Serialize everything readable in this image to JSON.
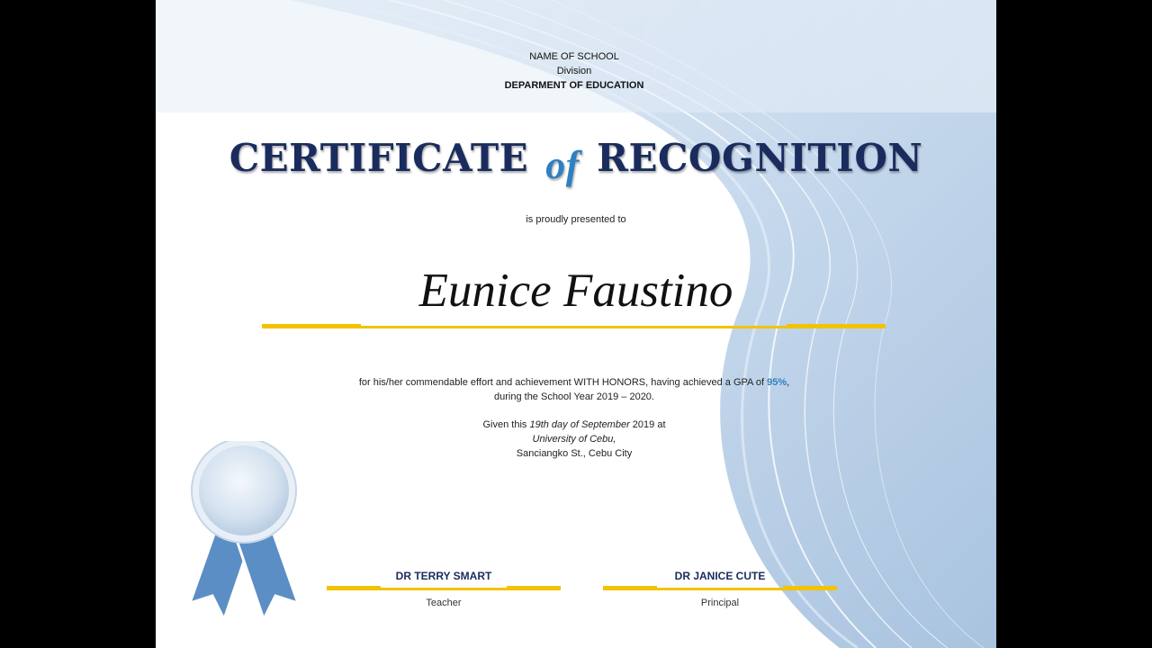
{
  "header": {
    "school": "NAME OF SCHOOL",
    "division": "Division",
    "department": "DEPARMENT OF EDUCATION"
  },
  "title": {
    "part1": "CERTIFICATE",
    "of": "of",
    "part2": "RECOGNITION"
  },
  "presented_to": "is proudly presented to",
  "recipient": "Eunice Faustino",
  "body": {
    "line1_prefix": "for his/her commendable effort and  achievement WITH HONORS, having achieved a GPA of ",
    "gpa": "95%",
    "line1_suffix": ",",
    "line2": "during the  School Year 2019 – 2020."
  },
  "given": {
    "prefix": "Given this ",
    "date": "19th day of September",
    "suffix": " 2019 at",
    "place": "University of Cebu,",
    "address": "Sanciangko St., Cebu City"
  },
  "signatories": {
    "teacher": {
      "name": "DR TERRY SMART",
      "role": "Teacher"
    },
    "principal": {
      "name": "DR JANICE CUTE",
      "role": "Principal"
    }
  },
  "colors": {
    "title": "#1a2c5e",
    "accent": "#2f7fc3",
    "gold_line": "#f2c300",
    "ribbon": "#5b8ec4"
  }
}
